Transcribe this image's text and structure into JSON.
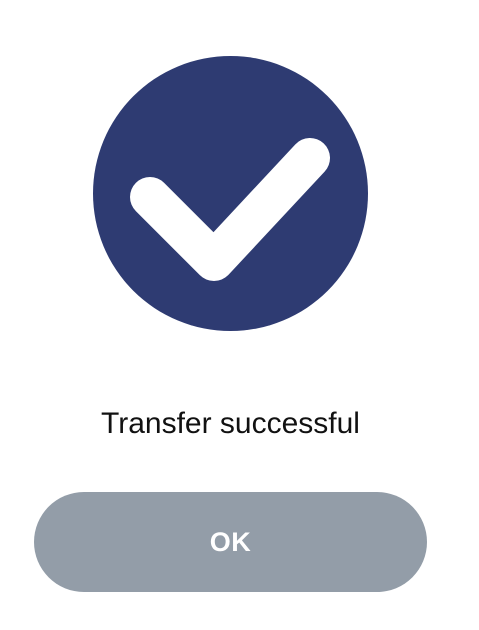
{
  "success": {
    "icon": "check-circle-icon",
    "icon_color": "#2e3b72",
    "message": "Transfer successful"
  },
  "actions": {
    "ok_label": "OK",
    "button_color": "#939da8"
  }
}
